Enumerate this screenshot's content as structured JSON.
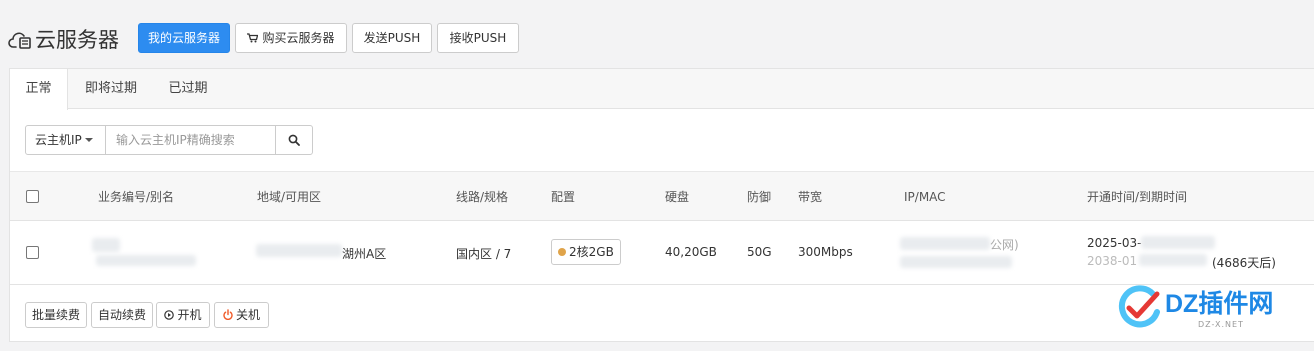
{
  "header": {
    "title": "云服务器",
    "buttons": {
      "my_servers": "我的云服务器",
      "buy_servers": "购买云服务器",
      "send_push": "发送PUSH",
      "receive_push": "接收PUSH"
    }
  },
  "tabs": [
    "正常",
    "即将过期",
    "已过期"
  ],
  "search": {
    "field_select": "云主机IP",
    "placeholder": "输入云主机IP精确搜索"
  },
  "table": {
    "columns": [
      "业务编号/别名",
      "地域/可用区",
      "线路/规格",
      "配置",
      "硬盘",
      "防御",
      "带宽",
      "IP/MAC",
      "开通时间/到期时间"
    ],
    "rows": [
      {
        "region_tail": "湖州A区",
        "line_spec": "国内区 / 7",
        "config": "2核2GB",
        "disk": "40,20GB",
        "defense": "50G",
        "bandwidth": "300Mbps",
        "ip_tail": "公网)",
        "open_time": "2025-03-",
        "expire_time": "2038-01",
        "days_left": "(4686天后)"
      }
    ]
  },
  "footer": {
    "batch_renew": "批量续费",
    "auto_renew": "自动续费",
    "power_on": "开机",
    "power_off": "关机"
  },
  "watermark": {
    "main": "DZ插件网",
    "sub": "DZ-X.NET"
  },
  "colors": {
    "primary": "#2d8cf0",
    "power_off": "#f05a28",
    "watermark": "#1e88e5"
  }
}
